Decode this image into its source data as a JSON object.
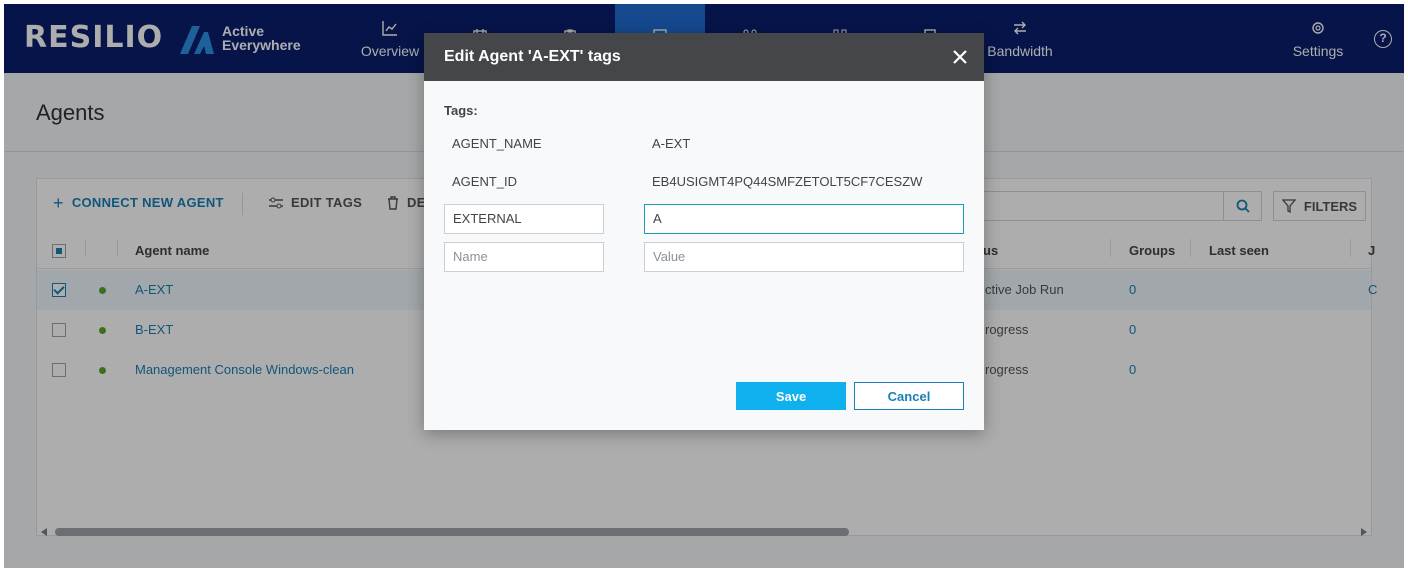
{
  "brand": {
    "name": "RESILIO",
    "product_line1": "Active",
    "product_line2": "Everywhere"
  },
  "nav": {
    "overview": "Overview",
    "bandwidth": "Bandwidth",
    "settings": "Settings",
    "help": "?"
  },
  "page": {
    "title": "Agents"
  },
  "toolbar": {
    "connect": "CONNECT NEW AGENT",
    "edit_tags": "EDIT TAGS",
    "delete": "DE",
    "filters": "FILTERS"
  },
  "table": {
    "headers": {
      "agent_name": "Agent name",
      "status": "us",
      "groups": "Groups",
      "last_seen": "Last seen",
      "extra": "J"
    },
    "rows": [
      {
        "name": "A-EXT",
        "status": "ctive Job Run",
        "groups": "0",
        "extra": "C"
      },
      {
        "name": "B-EXT",
        "status": "rogress",
        "groups": "0",
        "extra": ""
      },
      {
        "name": "Management Console Windows-clean",
        "status": "rogress",
        "groups": "0",
        "extra": ""
      }
    ]
  },
  "modal": {
    "title": "Edit Agent 'A-EXT' tags",
    "tags_label": "Tags:",
    "tags": [
      {
        "key": "AGENT_NAME",
        "value": "A-EXT"
      },
      {
        "key": "AGENT_ID",
        "value": "EB4USIGMT4PQ44SMFZETOLT5CF7CESZW"
      }
    ],
    "editable_tag": {
      "key": "EXTERNAL",
      "value": "A"
    },
    "new_tag": {
      "name_placeholder": "Name",
      "value_placeholder": "Value"
    },
    "save": "Save",
    "cancel": "Cancel"
  },
  "colors": {
    "nav_bg": "#0a1e6e",
    "nav_active": "#1f6bd0",
    "link": "#1a7fb5",
    "save_bg": "#0fb0ee",
    "status_ok": "#5aa52a",
    "modal_header": "#444649"
  }
}
